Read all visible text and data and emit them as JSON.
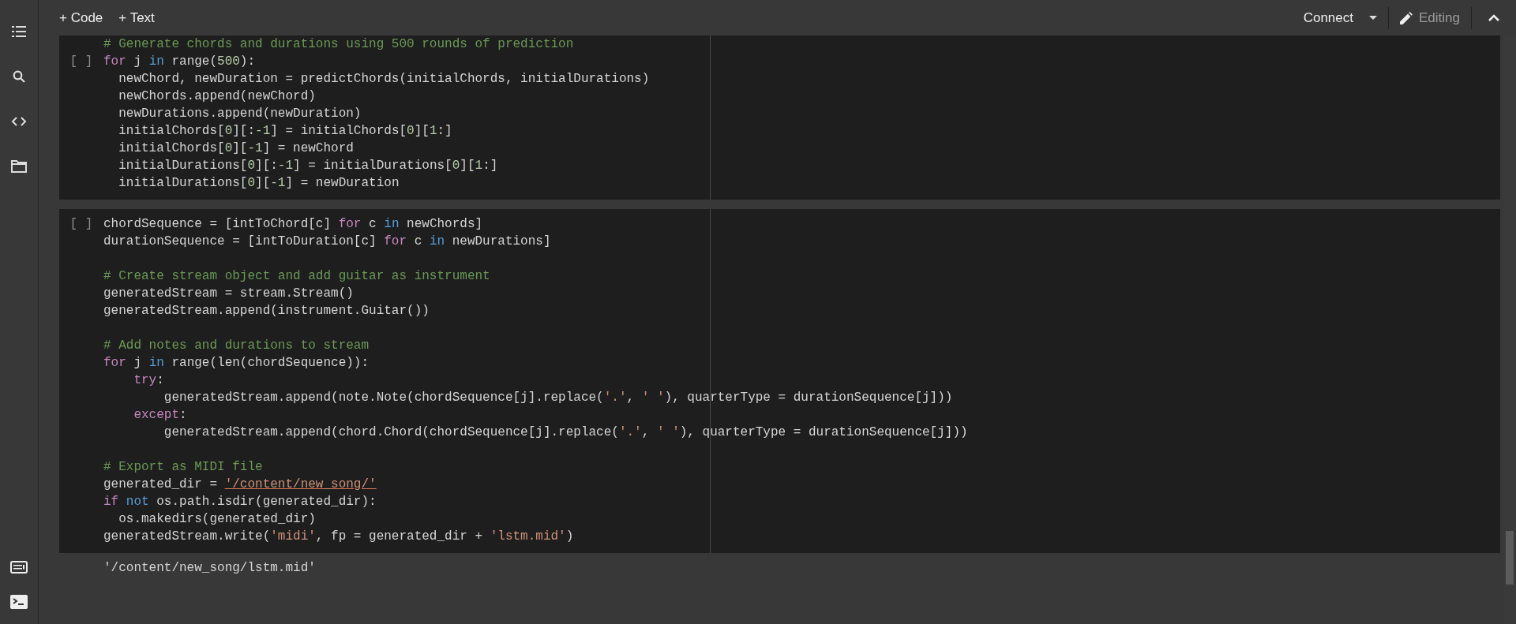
{
  "toolbar": {
    "insert_buttons": [
      {
        "label": "+ Code"
      },
      {
        "label": "+ Text"
      }
    ],
    "connect": {
      "label": "Connect"
    },
    "mode": {
      "label": "Editing"
    }
  },
  "cells": [
    {
      "run_label": "[ ]",
      "lines": [
        {
          "kind": "code",
          "segments": [
            {
              "text": "# Generate chords and durations using 500 rounds of prediction",
              "kind": "comment"
            }
          ]
        },
        {
          "kind": "code",
          "segments": [
            {
              "text": "for",
              "kind": "keyword"
            },
            {
              "text": " j ",
              "kind": "plain"
            },
            {
              "text": "in",
              "kind": "operator"
            },
            {
              "text": " range(",
              "kind": "plain"
            },
            {
              "text": "500",
              "kind": "number"
            },
            {
              "text": "):",
              "kind": "plain"
            }
          ]
        },
        {
          "kind": "code",
          "segments": [
            {
              "text": "  newChord, newDuration = predictChords(initialChords, initialDurations)",
              "kind": "plain"
            }
          ]
        },
        {
          "kind": "code",
          "segments": [
            {
              "text": "  newChords.append(newChord)",
              "kind": "plain"
            }
          ]
        },
        {
          "kind": "code",
          "segments": [
            {
              "text": "  newDurations.append(newDuration)",
              "kind": "plain"
            }
          ]
        },
        {
          "kind": "code",
          "segments": [
            {
              "text": "  initialChords[",
              "kind": "plain"
            },
            {
              "text": "0",
              "kind": "number"
            },
            {
              "text": "][:",
              "kind": "plain"
            },
            {
              "text": "-1",
              "kind": "number"
            },
            {
              "text": "] = initialChords[",
              "kind": "plain"
            },
            {
              "text": "0",
              "kind": "number"
            },
            {
              "text": "][",
              "kind": "plain"
            },
            {
              "text": "1",
              "kind": "number"
            },
            {
              "text": ":]",
              "kind": "plain"
            }
          ]
        },
        {
          "kind": "code",
          "segments": [
            {
              "text": "  initialChords[",
              "kind": "plain"
            },
            {
              "text": "0",
              "kind": "number"
            },
            {
              "text": "][",
              "kind": "plain"
            },
            {
              "text": "-1",
              "kind": "number"
            },
            {
              "text": "] = newChord",
              "kind": "plain"
            }
          ]
        },
        {
          "kind": "code",
          "segments": [
            {
              "text": "  initialDurations[",
              "kind": "plain"
            },
            {
              "text": "0",
              "kind": "number"
            },
            {
              "text": "][:",
              "kind": "plain"
            },
            {
              "text": "-1",
              "kind": "number"
            },
            {
              "text": "] = initialDurations[",
              "kind": "plain"
            },
            {
              "text": "0",
              "kind": "number"
            },
            {
              "text": "][",
              "kind": "plain"
            },
            {
              "text": "1",
              "kind": "number"
            },
            {
              "text": ":]",
              "kind": "plain"
            }
          ]
        },
        {
          "kind": "code",
          "segments": [
            {
              "text": "  initialDurations[",
              "kind": "plain"
            },
            {
              "text": "0",
              "kind": "number"
            },
            {
              "text": "][",
              "kind": "plain"
            },
            {
              "text": "-1",
              "kind": "number"
            },
            {
              "text": "] = newDuration",
              "kind": "plain"
            }
          ]
        }
      ]
    },
    {
      "run_label": "[ ]",
      "lines": [
        {
          "kind": "code",
          "segments": [
            {
              "text": "chordSequence = [intToChord[c] ",
              "kind": "plain"
            },
            {
              "text": "for",
              "kind": "keyword"
            },
            {
              "text": " c ",
              "kind": "plain"
            },
            {
              "text": "in",
              "kind": "operator"
            },
            {
              "text": " newChords]",
              "kind": "plain"
            }
          ]
        },
        {
          "kind": "code",
          "segments": [
            {
              "text": "durationSequence = [intToDuration[c] ",
              "kind": "plain"
            },
            {
              "text": "for",
              "kind": "keyword"
            },
            {
              "text": " c ",
              "kind": "plain"
            },
            {
              "text": "in",
              "kind": "operator"
            },
            {
              "text": " newDurations]",
              "kind": "plain"
            }
          ]
        },
        {
          "kind": "blank"
        },
        {
          "kind": "code",
          "segments": [
            {
              "text": "# Create stream object and add guitar as instrument",
              "kind": "comment"
            }
          ]
        },
        {
          "kind": "code",
          "segments": [
            {
              "text": "generatedStream = stream.Stream()",
              "kind": "plain"
            }
          ]
        },
        {
          "kind": "code",
          "segments": [
            {
              "text": "generatedStream.append(instrument.Guitar())",
              "kind": "plain"
            }
          ]
        },
        {
          "kind": "blank"
        },
        {
          "kind": "code",
          "segments": [
            {
              "text": "# Add notes and durations to stream",
              "kind": "comment"
            }
          ]
        },
        {
          "kind": "code",
          "segments": [
            {
              "text": "for",
              "kind": "keyword"
            },
            {
              "text": " j ",
              "kind": "plain"
            },
            {
              "text": "in",
              "kind": "operator"
            },
            {
              "text": " range(len(chordSequence)):",
              "kind": "plain"
            }
          ]
        },
        {
          "kind": "code",
          "segments": [
            {
              "text": "    try",
              "kind": "keyword"
            },
            {
              "text": ":",
              "kind": "plain"
            }
          ]
        },
        {
          "kind": "code",
          "segments": [
            {
              "text": "        generatedStream.append(note.Note(chordSequence[j].replace(",
              "kind": "plain"
            },
            {
              "text": "'.'",
              "kind": "string"
            },
            {
              "text": ", ",
              "kind": "plain"
            },
            {
              "text": "' '",
              "kind": "string"
            },
            {
              "text": "), quarterType = durationSequence[j]))",
              "kind": "plain"
            }
          ]
        },
        {
          "kind": "code",
          "segments": [
            {
              "text": "    except",
              "kind": "keyword"
            },
            {
              "text": ":",
              "kind": "plain"
            }
          ]
        },
        {
          "kind": "code",
          "segments": [
            {
              "text": "        generatedStream.append(chord.Chord(chordSequence[j].replace(",
              "kind": "plain"
            },
            {
              "text": "'.'",
              "kind": "string"
            },
            {
              "text": ", ",
              "kind": "plain"
            },
            {
              "text": "' '",
              "kind": "string"
            },
            {
              "text": "), quarterType = durationSequence[j]))",
              "kind": "plain"
            }
          ]
        },
        {
          "kind": "blank"
        },
        {
          "kind": "code",
          "segments": [
            {
              "text": "# Export as MIDI file",
              "kind": "comment"
            }
          ]
        },
        {
          "kind": "code",
          "segments": [
            {
              "text": "generated_dir = ",
              "kind": "plain"
            },
            {
              "text": "'/content/new_song/'",
              "kind": "path"
            }
          ]
        },
        {
          "kind": "code",
          "segments": [
            {
              "text": "if ",
              "kind": "keyword"
            },
            {
              "text": "not",
              "kind": "operator"
            },
            {
              "text": " os.path.isdir(generated_dir):",
              "kind": "plain"
            }
          ]
        },
        {
          "kind": "code",
          "segments": [
            {
              "text": "  os.makedirs(generated_dir)",
              "kind": "plain"
            }
          ]
        },
        {
          "kind": "code",
          "segments": [
            {
              "text": "generatedStream.write(",
              "kind": "plain"
            },
            {
              "text": "'midi'",
              "kind": "string"
            },
            {
              "text": ", fp = generated_dir + ",
              "kind": "plain"
            },
            {
              "text": "'lstm.mid'",
              "kind": "string"
            },
            {
              "text": ")",
              "kind": "plain"
            }
          ]
        }
      ],
      "output": "'/content/new_song/lstm.mid'"
    }
  ]
}
